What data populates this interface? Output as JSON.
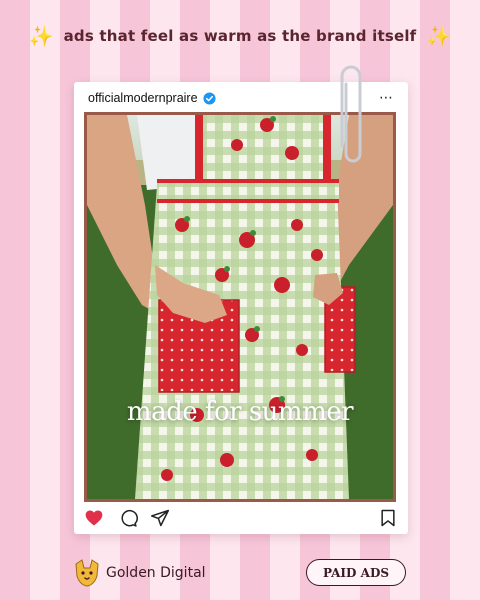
{
  "headline": {
    "text": "ads that feel as warm as the brand itself",
    "sparkle": "✨"
  },
  "post": {
    "username": "officialmodernpraire",
    "verified": true,
    "more_icon": "⋯",
    "overlay_text": "made for summer",
    "liked": true,
    "colors": {
      "like": "#e0304a",
      "verified": "#1c96f0"
    }
  },
  "footer": {
    "brand_name": "Golden Digital",
    "button_label": "PAID ADS"
  }
}
